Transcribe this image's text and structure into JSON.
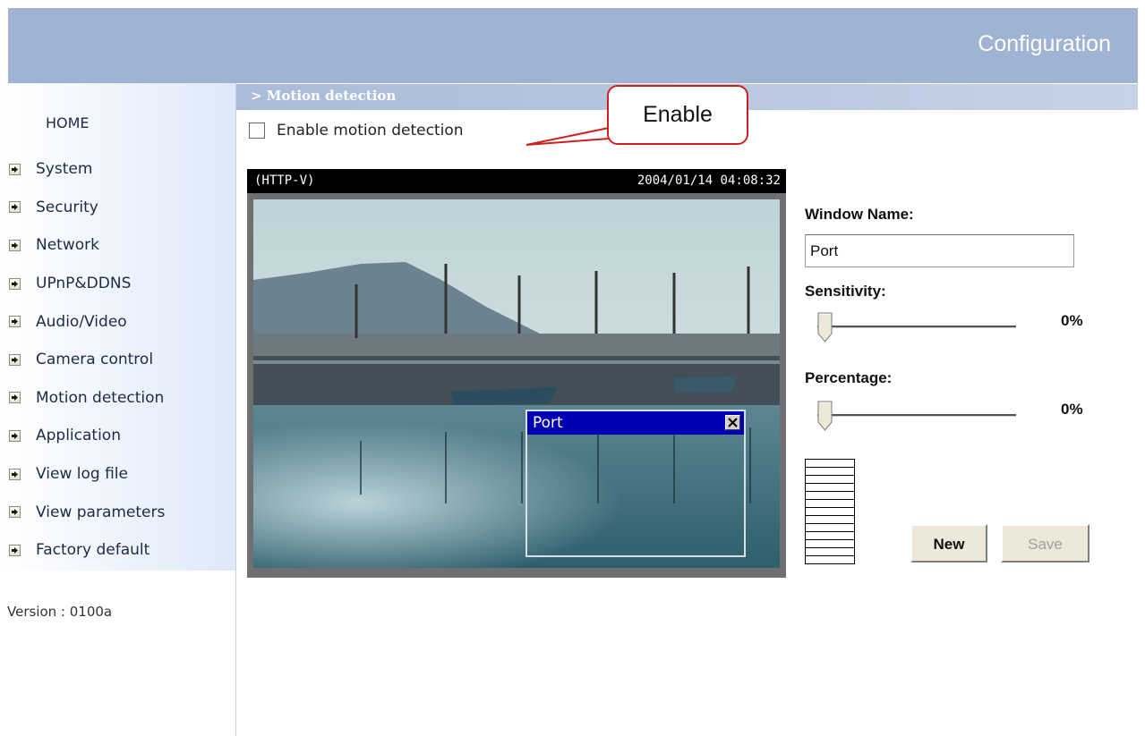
{
  "header": {
    "title": "Configuration"
  },
  "sidebar": {
    "home_label": "HOME",
    "items": [
      {
        "label": "System"
      },
      {
        "label": "Security"
      },
      {
        "label": "Network"
      },
      {
        "label": "UPnP&DDNS"
      },
      {
        "label": "Audio/Video"
      },
      {
        "label": "Camera control"
      },
      {
        "label": "Motion detection"
      },
      {
        "label": "Application"
      },
      {
        "label": "View log file"
      },
      {
        "label": "View parameters"
      },
      {
        "label": "Factory default"
      }
    ],
    "item_icon": "arrow-right-icon",
    "version": "Version : 0100a"
  },
  "main": {
    "breadcrumb": "> Motion detection",
    "enable_checkbox": {
      "label": "Enable motion detection",
      "checked": false
    },
    "callout": "Enable",
    "video": {
      "stream_label": "(HTTP-V)",
      "timestamp": "2004/01/14 04:08:32",
      "window": {
        "title": "Port",
        "close_icon": "close-icon"
      }
    },
    "controls": {
      "window_name_label": "Window Name:",
      "window_name_value": "Port",
      "sensitivity_label": "Sensitivity:",
      "sensitivity_value": "0%",
      "sensitivity_level": 0,
      "percentage_label": "Percentage:",
      "percentage_value": "0%",
      "percentage_level": 0,
      "new_button": "New",
      "save_button": "Save"
    }
  },
  "colors": {
    "header_bg": "#a0b3d3",
    "window_title_bg": "#0000b5",
    "callout_border": "#cc2020",
    "disabled_text": "#a0a0a0"
  }
}
